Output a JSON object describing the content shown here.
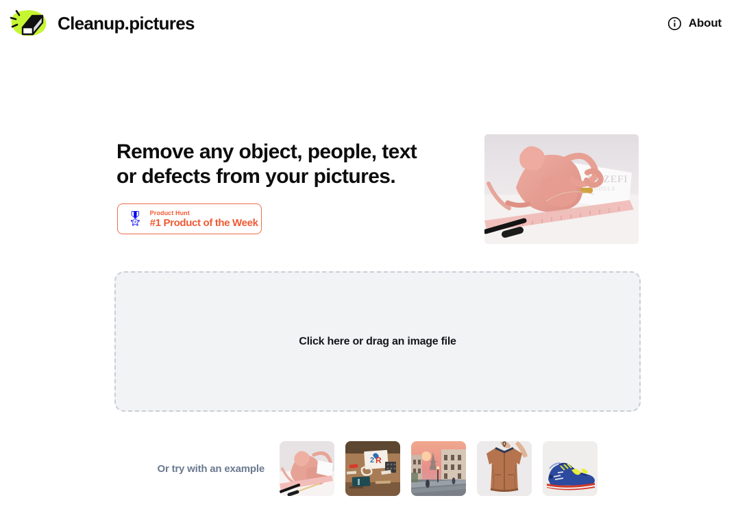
{
  "header": {
    "brand_name": "Cleanup.pictures",
    "logo_icon": "eraser-logo-icon",
    "about_label": "About",
    "about_icon": "info-circle-icon"
  },
  "hero": {
    "headline_line1": "Remove any object, people, text",
    "headline_line2": "or defects from your pictures.",
    "badge": {
      "icon": "medal-emoji",
      "medal_glyph": "🎖",
      "kicker": "Product Hunt",
      "title": "#1 Product of the Week",
      "border_color": "#ee6c4a",
      "text_color": "#ef5a33"
    },
    "image_alt": "pink-leather-bag-photo"
  },
  "dropzone": {
    "label": "Click here or drag an image file",
    "background_color": "#f2f3f5",
    "border_color": "#cbcdd6"
  },
  "examples": {
    "label": "Or try with an example",
    "label_color": "#6b7a90",
    "thumbnails": [
      {
        "name": "example-pink-bag",
        "alt": "pink bag on desk with ruler and pencils"
      },
      {
        "name": "example-desk-papers",
        "alt": "wooden desk with colorful lettering papers"
      },
      {
        "name": "example-paris-street",
        "alt": "paris street at sunset with eiffel tower"
      },
      {
        "name": "example-brown-jacket",
        "alt": "brown bomber jacket on hanger"
      },
      {
        "name": "example-blue-sneaker",
        "alt": "blue and red running sneaker"
      }
    ]
  },
  "colors": {
    "brand_green": "#c6f532",
    "text_dark": "#0d0d0d",
    "accent_orange": "#ef5a33",
    "page_background": "#ffffff"
  }
}
